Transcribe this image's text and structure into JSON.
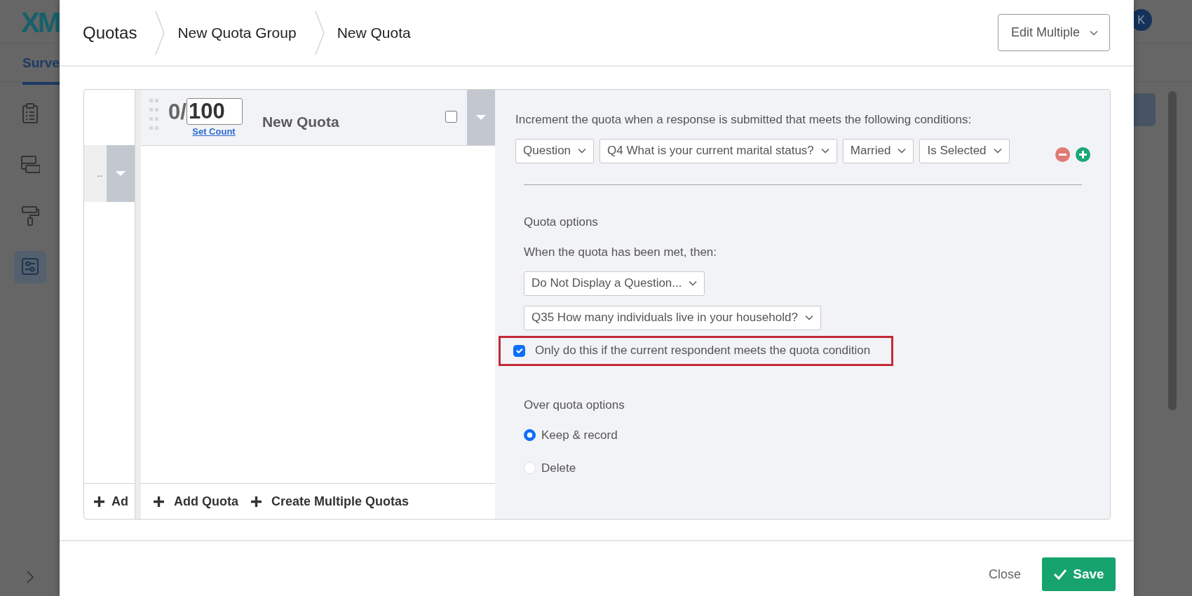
{
  "background": {
    "logo": "XM",
    "nav_tab": "Surve",
    "avatar": "K",
    "sidebar": {
      "items": [
        {
          "selected": false
        },
        {
          "selected": false
        },
        {
          "selected": false
        },
        {
          "selected": true
        }
      ]
    }
  },
  "modal": {
    "breadcrumbs": [
      "Quotas",
      "New Quota Group",
      "New Quota"
    ],
    "edit_button": "Edit Multiple",
    "group_list": {
      "item_label": "..",
      "add_label": "Ad"
    },
    "quota": {
      "count": "0/",
      "limit": "100",
      "set_count": "Set Count",
      "name": "New Quota",
      "checked": false
    },
    "list_actions": [
      "Add Quota",
      "Create Multiple Quotas"
    ],
    "conditions_title": "Increment the quota when a response is submitted that meets the following conditions:",
    "condition": [
      "Question",
      "Q4 What is your current marital status?",
      "Married",
      "Is Selected"
    ],
    "options_title": "Quota options",
    "met_label": "When the quota has been met, then:",
    "met_selects": [
      "Do Not Display a Question...",
      "Q35 How many individuals live in your household?"
    ],
    "only_if": {
      "label": "Only do this if the current respondent meets the quota condition",
      "checked": true,
      "highlighted": true
    },
    "over_title": "Over quota options",
    "over_options": [
      {
        "label": "Keep & record",
        "selected": true
      },
      {
        "label": "Delete",
        "selected": false
      }
    ],
    "footer": {
      "close": "Close",
      "save": "Save"
    }
  }
}
